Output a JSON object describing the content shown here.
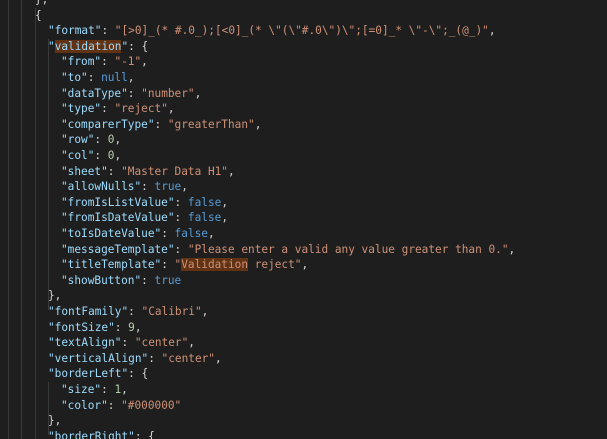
{
  "editor": {
    "language": "json",
    "colors": {
      "background": "#1e1e1e",
      "key": "#9cdcfe",
      "string": "#ce9178",
      "number": "#b5cea8",
      "keyword": "#569cd6",
      "punctuation": "#d4d4d4",
      "search_highlight": "#613214"
    },
    "search_term": "Validation",
    "lines": [
      {
        "indent": 1,
        "tokens": [
          {
            "t": "p",
            "v": "},"
          }
        ]
      },
      {
        "indent": 1,
        "tokens": [
          {
            "t": "p",
            "v": "{"
          }
        ]
      },
      {
        "indent": 2,
        "tokens": [
          {
            "t": "k",
            "v": "\"format\""
          },
          {
            "t": "p",
            "v": ": "
          },
          {
            "t": "s",
            "v": "\"[>0]_(* #.0_);[<0]_(* \\\"(\\\"#.0\\\")\\\";[=0]_* \\\"-\\\";_(@_)\""
          },
          {
            "t": "p",
            "v": ","
          }
        ]
      },
      {
        "indent": 2,
        "tokens": [
          {
            "t": "k",
            "v": "\""
          },
          {
            "t": "k",
            "v": "validation",
            "hl": true
          },
          {
            "t": "k",
            "v": "\""
          },
          {
            "t": "p",
            "v": ": {"
          }
        ]
      },
      {
        "indent": 3,
        "tokens": [
          {
            "t": "k",
            "v": "\"from\""
          },
          {
            "t": "p",
            "v": ": "
          },
          {
            "t": "s",
            "v": "\"-1\""
          },
          {
            "t": "p",
            "v": ","
          }
        ]
      },
      {
        "indent": 3,
        "tokens": [
          {
            "t": "k",
            "v": "\"to\""
          },
          {
            "t": "p",
            "v": ": "
          },
          {
            "t": "b",
            "v": "null"
          },
          {
            "t": "p",
            "v": ","
          }
        ]
      },
      {
        "indent": 3,
        "tokens": [
          {
            "t": "k",
            "v": "\"dataType\""
          },
          {
            "t": "p",
            "v": ": "
          },
          {
            "t": "s",
            "v": "\"number\""
          },
          {
            "t": "p",
            "v": ","
          }
        ]
      },
      {
        "indent": 3,
        "tokens": [
          {
            "t": "k",
            "v": "\"type\""
          },
          {
            "t": "p",
            "v": ": "
          },
          {
            "t": "s",
            "v": "\"reject\""
          },
          {
            "t": "p",
            "v": ","
          }
        ]
      },
      {
        "indent": 3,
        "tokens": [
          {
            "t": "k",
            "v": "\"comparerType\""
          },
          {
            "t": "p",
            "v": ": "
          },
          {
            "t": "s",
            "v": "\"greaterThan\""
          },
          {
            "t": "p",
            "v": ","
          }
        ]
      },
      {
        "indent": 3,
        "tokens": [
          {
            "t": "k",
            "v": "\"row\""
          },
          {
            "t": "p",
            "v": ": "
          },
          {
            "t": "n",
            "v": "0"
          },
          {
            "t": "p",
            "v": ","
          }
        ]
      },
      {
        "indent": 3,
        "tokens": [
          {
            "t": "k",
            "v": "\"col\""
          },
          {
            "t": "p",
            "v": ": "
          },
          {
            "t": "n",
            "v": "0"
          },
          {
            "t": "p",
            "v": ","
          }
        ]
      },
      {
        "indent": 3,
        "tokens": [
          {
            "t": "k",
            "v": "\"sheet\""
          },
          {
            "t": "p",
            "v": ": "
          },
          {
            "t": "s",
            "v": "\"Master Data H1\""
          },
          {
            "t": "p",
            "v": ","
          }
        ]
      },
      {
        "indent": 3,
        "tokens": [
          {
            "t": "k",
            "v": "\"allowNulls\""
          },
          {
            "t": "p",
            "v": ": "
          },
          {
            "t": "b",
            "v": "true"
          },
          {
            "t": "p",
            "v": ","
          }
        ]
      },
      {
        "indent": 3,
        "tokens": [
          {
            "t": "k",
            "v": "\"fromIsListValue\""
          },
          {
            "t": "p",
            "v": ": "
          },
          {
            "t": "b",
            "v": "false"
          },
          {
            "t": "p",
            "v": ","
          }
        ]
      },
      {
        "indent": 3,
        "tokens": [
          {
            "t": "k",
            "v": "\"fromIsDateValue\""
          },
          {
            "t": "p",
            "v": ": "
          },
          {
            "t": "b",
            "v": "false"
          },
          {
            "t": "p",
            "v": ","
          }
        ]
      },
      {
        "indent": 3,
        "tokens": [
          {
            "t": "k",
            "v": "\"toIsDateValue\""
          },
          {
            "t": "p",
            "v": ": "
          },
          {
            "t": "b",
            "v": "false"
          },
          {
            "t": "p",
            "v": ","
          }
        ]
      },
      {
        "indent": 3,
        "tokens": [
          {
            "t": "k",
            "v": "\"messageTemplate\""
          },
          {
            "t": "p",
            "v": ": "
          },
          {
            "t": "s",
            "v": "\"Please enter a valid any value greater than 0.\""
          },
          {
            "t": "p",
            "v": ","
          }
        ]
      },
      {
        "indent": 3,
        "tokens": [
          {
            "t": "k",
            "v": "\"titleTemplate\""
          },
          {
            "t": "p",
            "v": ": "
          },
          {
            "t": "s",
            "v": "\""
          },
          {
            "t": "s",
            "v": "Validation",
            "hl": true
          },
          {
            "t": "s",
            "v": " reject\""
          },
          {
            "t": "p",
            "v": ","
          }
        ]
      },
      {
        "indent": 3,
        "tokens": [
          {
            "t": "k",
            "v": "\"showButton\""
          },
          {
            "t": "p",
            "v": ": "
          },
          {
            "t": "b",
            "v": "true"
          }
        ]
      },
      {
        "indent": 2,
        "tokens": [
          {
            "t": "p",
            "v": "},"
          }
        ]
      },
      {
        "indent": 2,
        "tokens": [
          {
            "t": "k",
            "v": "\"fontFamily\""
          },
          {
            "t": "p",
            "v": ": "
          },
          {
            "t": "s",
            "v": "\"Calibri\""
          },
          {
            "t": "p",
            "v": ","
          }
        ]
      },
      {
        "indent": 2,
        "tokens": [
          {
            "t": "k",
            "v": "\"fontSize\""
          },
          {
            "t": "p",
            "v": ": "
          },
          {
            "t": "n",
            "v": "9"
          },
          {
            "t": "p",
            "v": ","
          }
        ]
      },
      {
        "indent": 2,
        "tokens": [
          {
            "t": "k",
            "v": "\"textAlign\""
          },
          {
            "t": "p",
            "v": ": "
          },
          {
            "t": "s",
            "v": "\"center\""
          },
          {
            "t": "p",
            "v": ","
          }
        ]
      },
      {
        "indent": 2,
        "tokens": [
          {
            "t": "k",
            "v": "\"verticalAlign\""
          },
          {
            "t": "p",
            "v": ": "
          },
          {
            "t": "s",
            "v": "\"center\""
          },
          {
            "t": "p",
            "v": ","
          }
        ]
      },
      {
        "indent": 2,
        "tokens": [
          {
            "t": "k",
            "v": "\"borderLeft\""
          },
          {
            "t": "p",
            "v": ": {"
          }
        ]
      },
      {
        "indent": 3,
        "tokens": [
          {
            "t": "k",
            "v": "\"size\""
          },
          {
            "t": "p",
            "v": ": "
          },
          {
            "t": "n",
            "v": "1"
          },
          {
            "t": "p",
            "v": ","
          }
        ]
      },
      {
        "indent": 3,
        "tokens": [
          {
            "t": "k",
            "v": "\"color\""
          },
          {
            "t": "p",
            "v": ": "
          },
          {
            "t": "s",
            "v": "\"#000000\""
          }
        ]
      },
      {
        "indent": 2,
        "tokens": [
          {
            "t": "p",
            "v": "},"
          }
        ]
      },
      {
        "indent": 2,
        "tokens": [
          {
            "t": "k",
            "v": "\"borderRight\""
          },
          {
            "t": "p",
            "v": ": {"
          }
        ]
      }
    ]
  }
}
